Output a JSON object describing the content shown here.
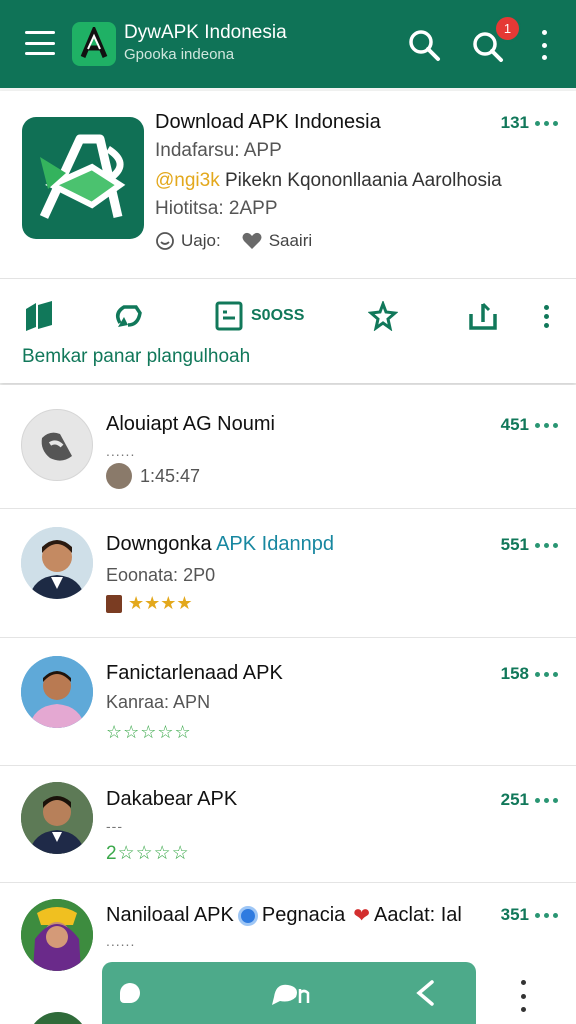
{
  "appbar": {
    "title": "DywAPK Indonesia",
    "subtitle": "Gpooka indeona",
    "notification_count": "1",
    "icons": [
      "menu-icon",
      "app-logo",
      "search-icon",
      "search-notification-icon",
      "more-vert-icon"
    ]
  },
  "featured": {
    "title": "Download APK Indonesia",
    "line1": "Indafarsu: APP",
    "line2_highlight": "@ngi3k",
    "line2_text": "Pikekn Kqononllaania Aarolhosia",
    "line3": "Hiotitsa: 2APP",
    "meta_label": "Uajo:",
    "meta_label2": "Saairi",
    "count": "131",
    "actions": {
      "act3_label": "S0OSS"
    },
    "caption": "Bemkar panar plangulhoah",
    "icons": [
      "bookmark-icon",
      "refresh-icon",
      "note-icon",
      "star-icon",
      "share-icon",
      "more-vert-icon"
    ]
  },
  "list": [
    {
      "title": "Alouiapt AG Noumi",
      "sub": "......",
      "time": "1:45:47",
      "count": "451"
    },
    {
      "title": "Downgonka ",
      "title_accent": "APK Idannpd",
      "sub": "Eoonata: 2P0",
      "stars": "★★★★",
      "count": "551"
    },
    {
      "title": "Fanictarlenaad APK",
      "sub": "Kanraa: APN",
      "stars": "☆☆☆☆☆",
      "count": "158"
    },
    {
      "title": "Dakabear APK",
      "sub": "---",
      "stars": "2☆☆☆☆",
      "count": "251"
    },
    {
      "title": "Naniloaal APK",
      "title_mid": "Pegnacia",
      "title_end": "Aaclat: Ial",
      "sub": "......",
      "count": "351"
    }
  ],
  "colors": {
    "primary": "#0f7357",
    "accent": "#11785a",
    "badge": "#e53935",
    "star_gold": "#e3a81c",
    "bottom_bar": "#4daa8a"
  }
}
